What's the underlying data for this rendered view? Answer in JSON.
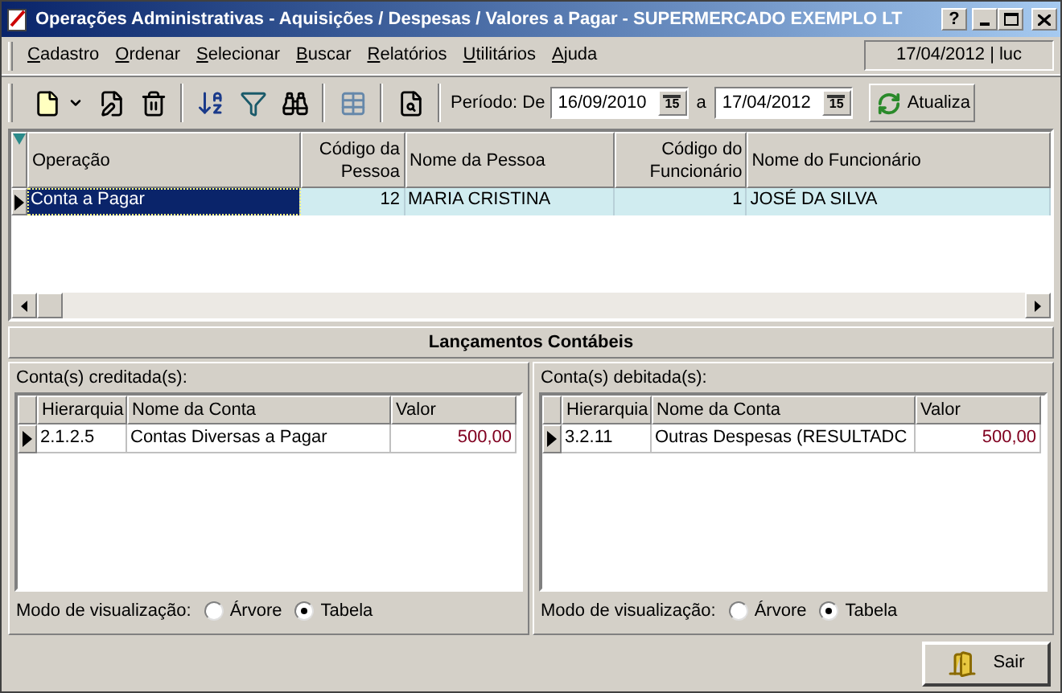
{
  "window": {
    "title": "Operações Administrativas - Aquisições / Despesas / Valores a Pagar - SUPERMERCADO EXEMPLO LT",
    "help_button": "?"
  },
  "menu": [
    {
      "label": "Cadastro"
    },
    {
      "label": "Ordenar"
    },
    {
      "label": "Selecionar"
    },
    {
      "label": "Buscar"
    },
    {
      "label": "Relatórios"
    },
    {
      "label": "Utilitários"
    },
    {
      "label": "Ajuda"
    }
  ],
  "status": "17/04/2012 | luc",
  "toolbar": {
    "period_label": "Período: De",
    "from": "16/09/2010",
    "to_label": "a",
    "to": "17/04/2012",
    "from_calendar": "15",
    "to_calendar": "15",
    "refresh_button": "Atualiza"
  },
  "grid": {
    "columns": [
      {
        "label": "Operação"
      },
      {
        "label": "Código da Pessoa"
      },
      {
        "label": "Nome da Pessoa"
      },
      {
        "label": "Código do Funcionário"
      },
      {
        "label": "Nome do Funcionário"
      }
    ],
    "rows": [
      {
        "cells": [
          "Conta a Pagar",
          "12",
          "MARIA CRISTINA",
          "1",
          "JOSÉ DA SILVA"
        ],
        "selected": true
      }
    ]
  },
  "section_title": "Lançamentos Contábeis",
  "panels": [
    {
      "label": "Conta(s) creditada(s):",
      "columns": [
        "Hierarquia",
        "Nome da Conta",
        "Valor"
      ],
      "rows": [
        [
          "2.1.2.5",
          "Contas Diversas a Pagar",
          "500,00"
        ]
      ],
      "view_label": "Modo de visualização:",
      "options": [
        {
          "label": "Árvore",
          "selected": false
        },
        {
          "label": "Tabela",
          "selected": true
        }
      ]
    },
    {
      "label": "Conta(s) debitada(s):",
      "columns": [
        "Hierarquia",
        "Nome da Conta",
        "Valor"
      ],
      "rows": [
        [
          "3.2.11",
          "Outras Despesas (RESULTADC",
          "500,00"
        ]
      ],
      "view_label": "Modo de visualização:",
      "options": [
        {
          "label": "Árvore",
          "selected": false
        },
        {
          "label": "Tabela",
          "selected": true
        }
      ]
    }
  ],
  "exit_button": "Sair"
}
